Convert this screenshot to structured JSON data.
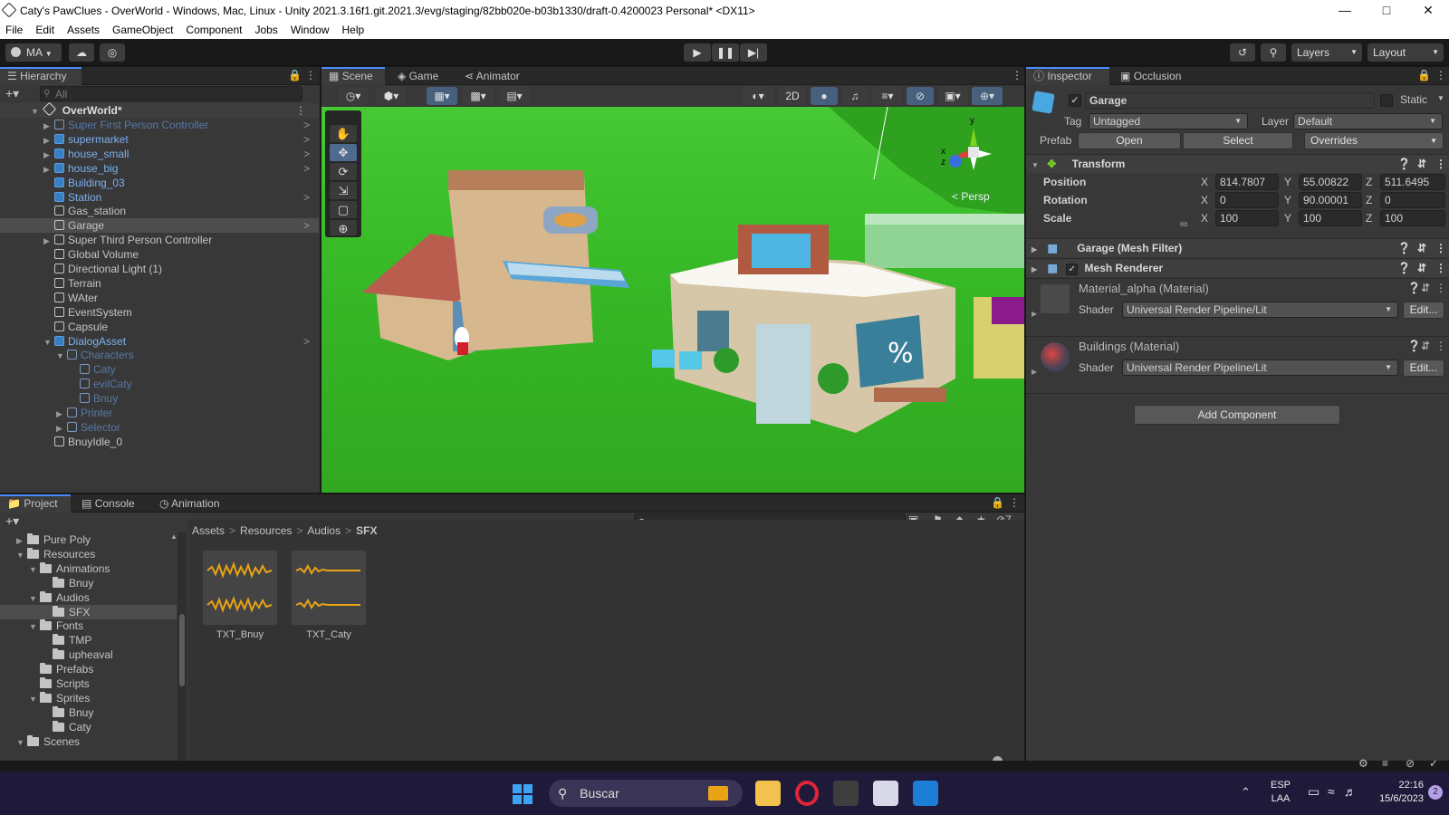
{
  "window": {
    "title": "Caty's PawClues - OverWorld - Windows, Mac, Linux - Unity 2021.3.16f1.git.2021.3/evg/staging/82bb020e-b03b1330/draft-0.4200023 Personal* <DX11>"
  },
  "menu": [
    "File",
    "Edit",
    "Assets",
    "GameObject",
    "Component",
    "Jobs",
    "Window",
    "Help"
  ],
  "toolbar": {
    "account": "MA",
    "layers": "Layers",
    "layout": "Layout"
  },
  "hierarchy": {
    "tab": "Hierarchy",
    "search_placeholder": "All",
    "scene": "OverWorld*",
    "items": [
      {
        "label": "Super First Person Controller",
        "style": "prefab-faded"
      },
      {
        "label": "supermarket",
        "style": "prefab"
      },
      {
        "label": "house_small",
        "style": "prefab"
      },
      {
        "label": "house_big",
        "style": "prefab"
      },
      {
        "label": "Building_03",
        "style": "prefab"
      },
      {
        "label": "Station",
        "style": "prefab"
      },
      {
        "label": "Gas_station",
        "style": "normal"
      },
      {
        "label": "Garage",
        "style": "normal"
      },
      {
        "label": "Super Third Person Controller",
        "style": "normal"
      },
      {
        "label": "Global Volume",
        "style": "normal"
      },
      {
        "label": "Directional Light (1)",
        "style": "normal"
      },
      {
        "label": "Terrain",
        "style": "normal"
      },
      {
        "label": "WAter",
        "style": "normal"
      },
      {
        "label": "EventSystem",
        "style": "normal"
      },
      {
        "label": "Capsule",
        "style": "normal"
      },
      {
        "label": "DialogAsset",
        "style": "prefab"
      },
      {
        "label": "Characters",
        "style": "prefab-faded"
      },
      {
        "label": "Caty",
        "style": "prefab-faded"
      },
      {
        "label": "evilCaty",
        "style": "prefab-faded"
      },
      {
        "label": "Bnuy",
        "style": "prefab-faded"
      },
      {
        "label": "Printer",
        "style": "prefab-faded"
      },
      {
        "label": "Selector",
        "style": "prefab-faded"
      },
      {
        "label": "BnuyIdle_0",
        "style": "normal"
      }
    ]
  },
  "scene_tabs": [
    "Scene",
    "Game",
    "Animator"
  ],
  "scene": {
    "mode_2d": "2D",
    "persp": "< Persp",
    "gizmo_y": "y",
    "gizmo_x": "x",
    "gizmo_z": "z"
  },
  "inspector": {
    "tabs": [
      "Inspector",
      "Occlusion"
    ],
    "object_name": "Garage",
    "static_label": "Static",
    "tag_label": "Tag",
    "tag_value": "Untagged",
    "layer_label": "Layer",
    "layer_value": "Default",
    "prefab_label": "Prefab",
    "open": "Open",
    "select": "Select",
    "overrides": "Overrides",
    "transform": {
      "title": "Transform",
      "position": {
        "label": "Position",
        "x": "814.7807",
        "y": "55.00822",
        "z": "511.6495"
      },
      "rotation": {
        "label": "Rotation",
        "x": "0",
        "y": "90.00001",
        "z": "0"
      },
      "scale": {
        "label": "Scale",
        "x": "100",
        "y": "100",
        "z": "100"
      }
    },
    "mesh_filter": "Garage (Mesh Filter)",
    "mesh_renderer": "Mesh Renderer",
    "materials": [
      {
        "name": "Material_alpha (Material)",
        "shader_label": "Shader",
        "shader": "Universal Render Pipeline/Lit",
        "edit": "Edit..."
      },
      {
        "name": "Buildings (Material)",
        "shader_label": "Shader",
        "shader": "Universal Render Pipeline/Lit",
        "edit": "Edit..."
      }
    ],
    "add_component": "Add Component"
  },
  "project": {
    "tabs": [
      "Project",
      "Console",
      "Animation"
    ],
    "breadcrumb": [
      "Assets",
      "Resources",
      "Audios",
      "SFX"
    ],
    "hidden_count": "7",
    "tree": [
      {
        "label": "Pure Poly",
        "depth": 0
      },
      {
        "label": "Resources",
        "depth": 0
      },
      {
        "label": "Animations",
        "depth": 1
      },
      {
        "label": "Bnuy",
        "depth": 2
      },
      {
        "label": "Audios",
        "depth": 1
      },
      {
        "label": "SFX",
        "depth": 2
      },
      {
        "label": "Fonts",
        "depth": 1
      },
      {
        "label": "TMP",
        "depth": 2
      },
      {
        "label": "upheaval",
        "depth": 2
      },
      {
        "label": "Prefabs",
        "depth": 1
      },
      {
        "label": "Scripts",
        "depth": 1
      },
      {
        "label": "Sprites",
        "depth": 1
      },
      {
        "label": "Bnuy",
        "depth": 2
      },
      {
        "label": "Caty",
        "depth": 2
      },
      {
        "label": "Scenes",
        "depth": 0
      }
    ],
    "assets": [
      "TXT_Bnuy",
      "TXT_Caty"
    ]
  },
  "taskbar": {
    "search": "Buscar",
    "lang1": "ESP",
    "lang2": "LAA",
    "time": "22:16",
    "date": "15/6/2023",
    "notif": "2"
  },
  "colors": {
    "accent": "#4a8bff",
    "prefab": "#7bb0f0",
    "grass": "#3fbf2a",
    "waveform": "#e8a317"
  }
}
